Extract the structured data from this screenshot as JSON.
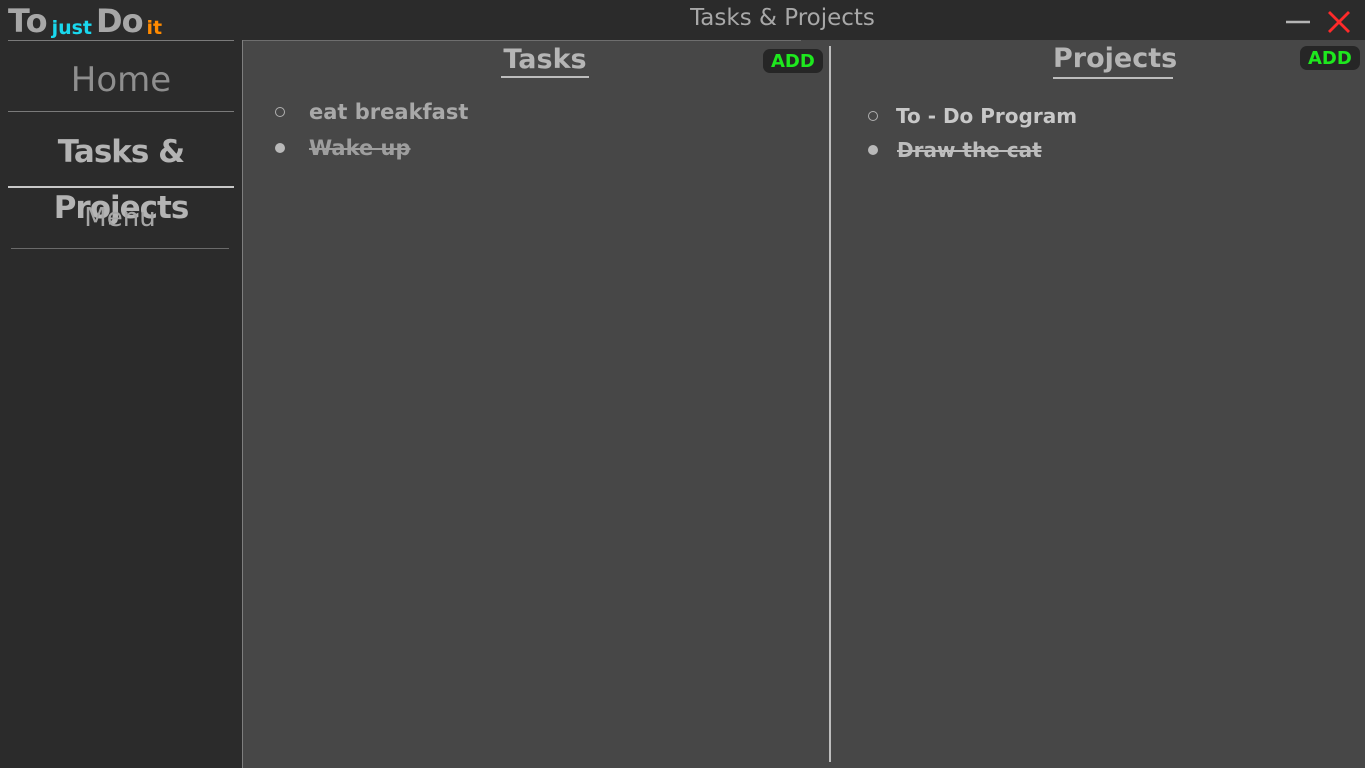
{
  "app": {
    "logo": {
      "to": "To",
      "just": "just",
      "do": "Do",
      "it": "it"
    },
    "window_title": "Tasks & Projects"
  },
  "sidebar": {
    "items": [
      {
        "label": "Home"
      },
      {
        "label": "Tasks & Projects",
        "active": true
      },
      {
        "label": "Menu"
      }
    ]
  },
  "tasks": {
    "title": "Tasks",
    "add_label": "ADD",
    "items": [
      {
        "label": "eat breakfast",
        "done": false
      },
      {
        "label": "Wake up",
        "done": true
      }
    ]
  },
  "projects": {
    "title": "Projects",
    "add_label": "ADD",
    "items": [
      {
        "label": "To - Do Program",
        "done": false
      },
      {
        "label": "Draw the cat",
        "done": true
      }
    ]
  },
  "colors": {
    "background": "#2b2b2b",
    "panel": "#474747",
    "add_text": "#1ee81e",
    "close_icon": "#ff2a2a",
    "logo_just": "#19d8ee",
    "logo_it": "#ff8a00"
  },
  "icons": {
    "minimize": "minimize-icon",
    "close": "close-icon",
    "unchecked": "radio-empty-icon",
    "checked": "radio-filled-icon"
  }
}
